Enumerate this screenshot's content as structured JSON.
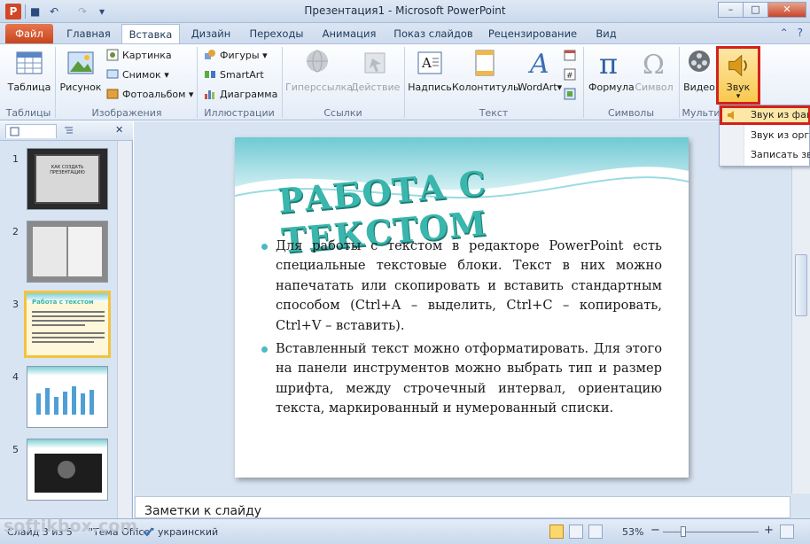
{
  "window": {
    "title": "Презентация1 - Microsoft PowerPoint",
    "app_letter": "P",
    "controls": {
      "minimize": "–",
      "maximize": "□",
      "close": "✕"
    }
  },
  "qat": {
    "save": "■",
    "undo": "↶",
    "redo": "↷",
    "customize": "▾"
  },
  "tabs": [
    {
      "label": "Файл",
      "active": false
    },
    {
      "label": "Главная",
      "active": false
    },
    {
      "label": "Вставка",
      "active": true
    },
    {
      "label": "Дизайн",
      "active": false
    },
    {
      "label": "Переходы",
      "active": false
    },
    {
      "label": "Анимация",
      "active": false
    },
    {
      "label": "Показ слайдов",
      "active": false
    },
    {
      "label": "Рецензирование",
      "active": false
    },
    {
      "label": "Вид",
      "active": false
    }
  ],
  "help": {
    "minimize_ribbon": "⌃",
    "help": "?"
  },
  "ribbon": {
    "groups": [
      {
        "label": "Таблицы"
      },
      {
        "label": "Изображения"
      },
      {
        "label": "Иллюстрации"
      },
      {
        "label": "Ссылки"
      },
      {
        "label": "Текст"
      },
      {
        "label": "Символы"
      },
      {
        "label": "Мульти"
      }
    ],
    "buttons": {
      "table": "Таблица",
      "picture": "Рисунок",
      "clipart": "Картинка",
      "screenshot": "Снимок",
      "photoalbum": "Фотоальбом",
      "shapes": "Фигуры",
      "smartart": "SmartArt",
      "chart": "Диаграмма",
      "hyperlink": "Гиперссылка",
      "action": "Действие",
      "textbox": "Надпись",
      "headerfooter": "Колонтитулы",
      "wordart": "WordArt",
      "formula": "Формула",
      "symbol": "Символ",
      "video": "Видео",
      "sound": "Звук",
      "dropdown_arrow": "▾"
    }
  },
  "sound_menu": {
    "items": [
      {
        "label": "Звук из файла...",
        "highlighted": true
      },
      {
        "label": "Звук из организатора клипов..."
      },
      {
        "label": "Записать звук..."
      }
    ]
  },
  "slides_pane": {
    "tab_close": "✕",
    "slides": [
      {
        "number": "1",
        "title": "КАК СОЗДАТЬ ПРЕЗЕНТАЦИЮ",
        "selected": false
      },
      {
        "number": "2",
        "selected": false
      },
      {
        "number": "3",
        "title": "Работа с текстом",
        "selected": true
      },
      {
        "number": "4",
        "selected": false
      },
      {
        "number": "5",
        "selected": false
      }
    ]
  },
  "slide": {
    "title": "РАБОТА С ТЕКСТОМ",
    "bullets": [
      "Для работы с текстом в редакторе PowerPoint есть специальные текстовые блоки. Текст в них можно напечатать или скопировать и вставить стандартным способом (Ctrl+A – выделить, Ctrl+C – копировать, Ctrl+V – вставить).",
      "Вставленный текст можно отформатировать. Для этого на панели инструментов можно выбрать тип и размер шрифта, между строчечный интервал, ориентацию текста, маркированный и нумерованный списки."
    ]
  },
  "notes": {
    "placeholder": "Заметки к слайду"
  },
  "status": {
    "slide_info": "Слайд 3 из 5",
    "theme": "\"Тема Office\"",
    "language": "украинский",
    "zoom": "53%",
    "zoom_minus": "−",
    "zoom_plus": "+"
  },
  "watermark": "softikbox.com",
  "colors": {
    "accent": "#39b6ad",
    "file_tab": "#d24726",
    "highlight_border": "#d3211d",
    "highlight_fill": "#f9c94e"
  }
}
